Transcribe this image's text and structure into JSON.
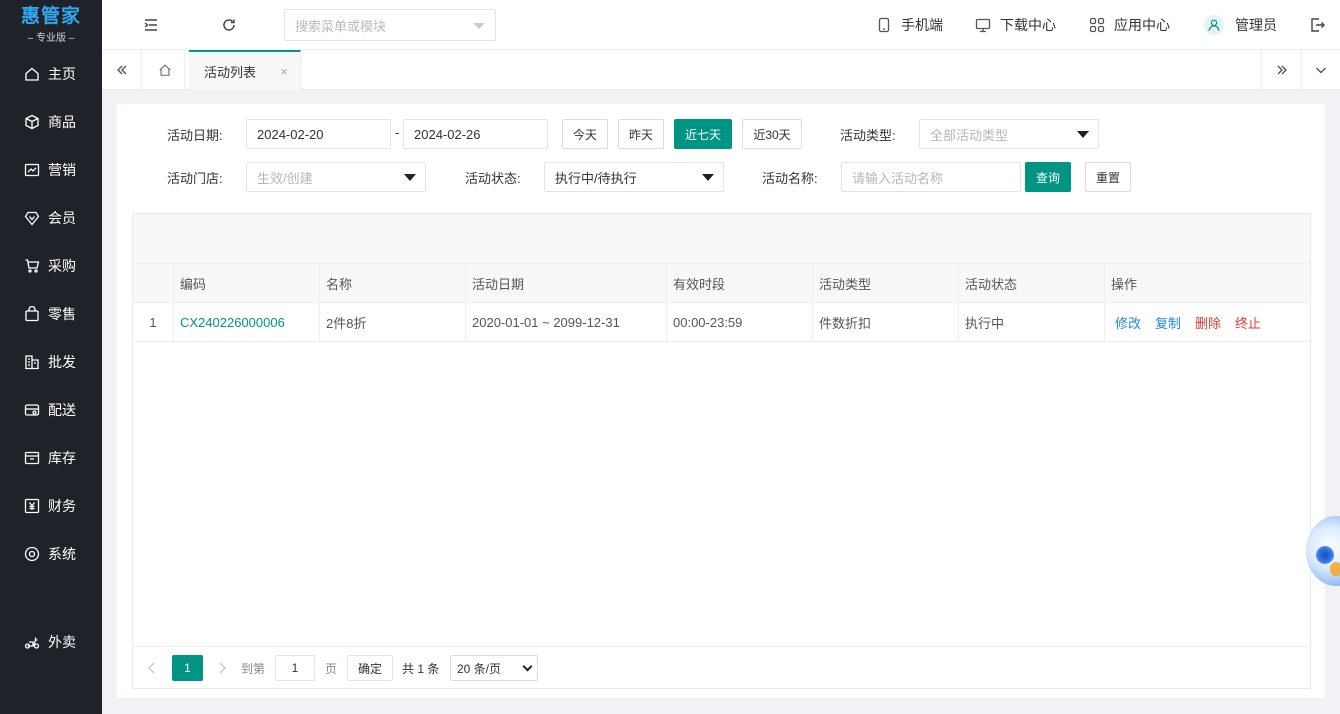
{
  "brand": {
    "name": "惠管家",
    "edition": "– 专业版 –"
  },
  "sidebar": {
    "items": [
      {
        "label": "主页",
        "icon": "home-icon"
      },
      {
        "label": "商品",
        "icon": "box-icon"
      },
      {
        "label": "营销",
        "icon": "chart-icon"
      },
      {
        "label": "会员",
        "icon": "diamond-icon"
      },
      {
        "label": "采购",
        "icon": "cart-icon"
      },
      {
        "label": "零售",
        "icon": "bag-icon"
      },
      {
        "label": "批发",
        "icon": "building-icon"
      },
      {
        "label": "配送",
        "icon": "delivery-icon"
      },
      {
        "label": "库存",
        "icon": "inventory-icon"
      },
      {
        "label": "财务",
        "icon": "yen-icon"
      },
      {
        "label": "系统",
        "icon": "settings-icon"
      },
      {
        "label": "外卖",
        "icon": "scooter-icon"
      }
    ]
  },
  "header": {
    "search_placeholder": "搜索菜单或模块",
    "mobile": "手机端",
    "download": "下载中心",
    "apps": "应用中心",
    "user": "管理员"
  },
  "tabs": {
    "active": "活动列表"
  },
  "filters": {
    "date_label": "活动日期:",
    "date_start": "2024-02-20",
    "date_sep": "-",
    "date_end": "2024-02-26",
    "today": "今天",
    "yesterday": "昨天",
    "last7": "近七天",
    "last30": "近30天",
    "type_label": "活动类型:",
    "type_value": "全部活动类型",
    "store_label": "活动门店:",
    "store_value": "生效/创建",
    "status_label": "活动状态:",
    "status_value": "执行中/待执行",
    "name_label": "活动名称:",
    "name_placeholder": "请输入活动名称",
    "query": "查询",
    "reset": "重置"
  },
  "table": {
    "headers": [
      "编码",
      "名称",
      "活动日期",
      "有效时段",
      "活动类型",
      "活动状态",
      "操作"
    ],
    "rows": [
      {
        "index": "1",
        "code": "CX240226000006",
        "name": "2件8折",
        "date": "2020-01-01 ~ 2099-12-31",
        "period": "00:00-23:59",
        "type": "件数折扣",
        "status": "执行中",
        "actions": {
          "edit": "修改",
          "copy": "复制",
          "delete": "删除",
          "stop": "终止"
        }
      }
    ]
  },
  "pager": {
    "current": "1",
    "goto_label": "到第",
    "goto_value": "1",
    "page_unit": "页",
    "confirm": "确定",
    "total": "共 1 条",
    "page_size": "20 条/页"
  },
  "colors": {
    "primary": "#009485",
    "sidebar": "#1f2329",
    "brand": "#2fa8f0",
    "link": "#1e88e5",
    "danger": "#e53935"
  }
}
